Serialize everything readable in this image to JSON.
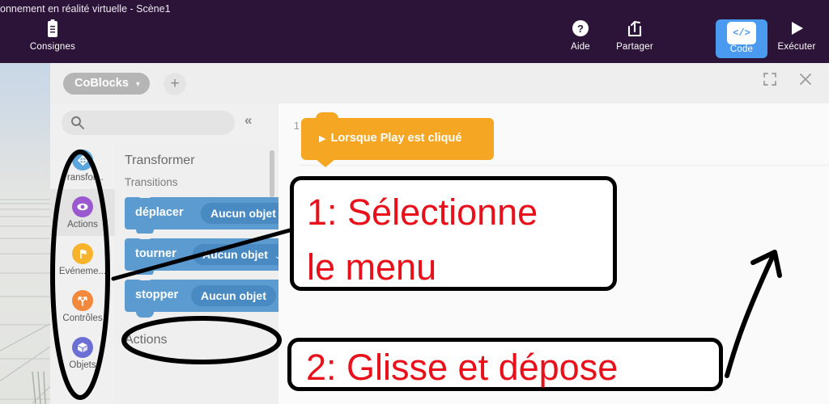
{
  "window": {
    "title": "onnement en réalité virtuelle - Scène1"
  },
  "appbar": {
    "consignes": {
      "label": "Consignes",
      "icon": "clipboard-icon"
    },
    "aide": {
      "label": "Aide",
      "icon": "question-circle-icon"
    },
    "partager": {
      "label": "Partager",
      "icon": "share-icon"
    },
    "code": {
      "label": "Code",
      "icon": "code-brackets-icon",
      "chip": "</>",
      "active": true,
      "color": "#4a9bf0"
    },
    "executer": {
      "label": "Exécuter",
      "icon": "play-icon"
    }
  },
  "editor": {
    "tab": {
      "label": "CoBlocks",
      "chevron": "chevron-down-icon"
    },
    "add_button": "+",
    "fullscreen_icon": "fullscreen-icon",
    "close_icon": "close-icon",
    "search": {
      "value": "",
      "placeholder": "",
      "icon": "search-icon"
    },
    "collapse": "«"
  },
  "toolbox": {
    "categories": [
      {
        "label": "Transfor...",
        "icon": "move-arrows-icon",
        "color": "#5aa6dd",
        "selected": false
      },
      {
        "label": "Actions",
        "icon": "eye-icon",
        "color": "#9b59d0",
        "selected": true
      },
      {
        "label": "Evéneme...",
        "icon": "flag-icon",
        "color": "#f7b32b",
        "selected": false
      },
      {
        "label": "Contrôles",
        "icon": "branch-icon",
        "color": "#f2883c",
        "selected": false
      },
      {
        "label": "Objets",
        "icon": "cube-icon",
        "color": "#6b6fd4",
        "selected": false
      }
    ]
  },
  "flyout": {
    "heading": "Transformer",
    "subheading": "Transitions",
    "blocks": [
      {
        "label": "déplacer",
        "field": "Aucun objet",
        "dropdown": "",
        "color": "#5b9bd0"
      },
      {
        "label": "tourner",
        "field": "Aucun objet",
        "dropdown": "⌄",
        "color": "#5b9bd0"
      },
      {
        "label": "stopper",
        "field": "Aucun objet",
        "dropdown": "",
        "color": "#5b9bd0"
      }
    ],
    "footer_heading": "Actions"
  },
  "workspace": {
    "line_number": "1",
    "hat_block": {
      "label": "Lorsque Play est cliqué",
      "icon": "play-triangle-icon",
      "color": "#f5a623"
    }
  },
  "annotations": {
    "callout1_line1": "1: Sélectionne",
    "callout1_line2": "le menu",
    "callout2": "2: Glisse et dépose",
    "text_color": "#e8101a",
    "border_color": "#000000"
  }
}
